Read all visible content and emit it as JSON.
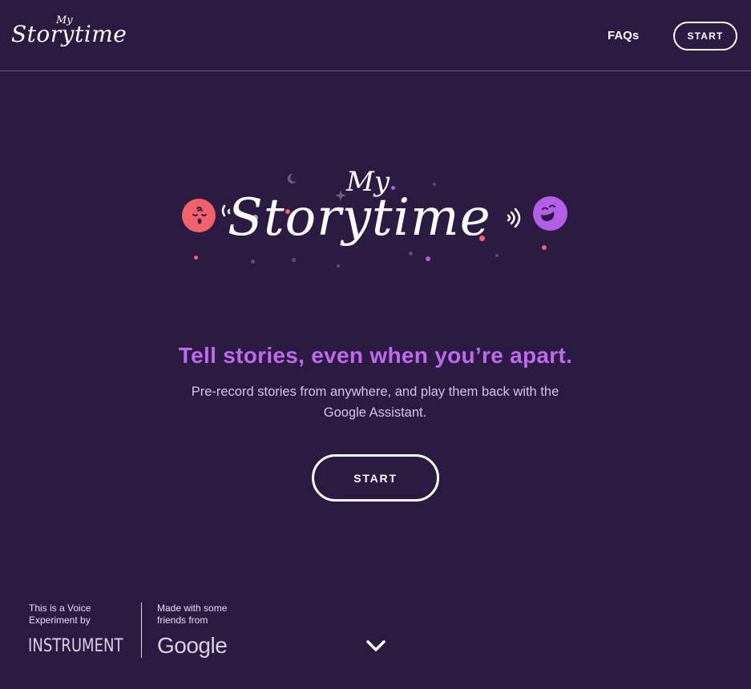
{
  "header": {
    "logo": {
      "my": "My",
      "word": "Storytime"
    },
    "nav": {
      "faqs_label": "FAQs",
      "start_label": "START"
    }
  },
  "hero": {
    "logo": {
      "my": "My",
      "word": "Storytime"
    },
    "tagline": "Tell stories, even when you’re apart.",
    "subtext": "Pre-record stories from anywhere, and play them back with the Google Assistant.",
    "start_label": "START"
  },
  "footer": {
    "left_text": "This is a Voice Experiment by",
    "left_brand": "INSTRUMENT",
    "right_text": "Made with some friends from",
    "right_brand": "Google"
  },
  "icons": {
    "scroll": "chevron-down-icon",
    "face_left": "sleeping-face-icon",
    "face_right": "laughing-face-icon"
  },
  "colors": {
    "background": "#2b1b42",
    "accent_purple": "#c069ef",
    "face_left": "#f1626b",
    "face_right": "#b25ee5"
  }
}
